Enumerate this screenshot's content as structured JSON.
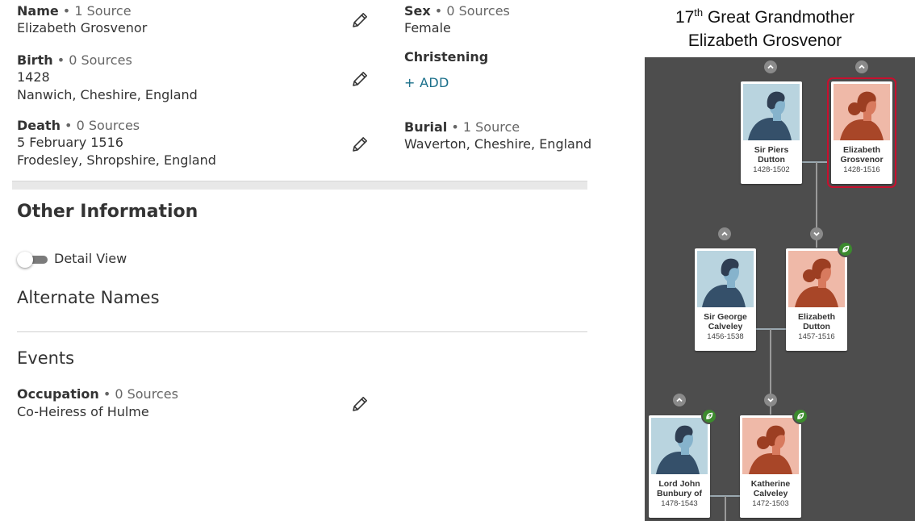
{
  "vitals": {
    "name": {
      "label": "Name",
      "sources": " • 1 Source",
      "value": "Elizabeth Grosvenor"
    },
    "sex": {
      "label": "Sex",
      "sources": " • 0 Sources",
      "value": "Female"
    },
    "birth": {
      "label": "Birth",
      "sources": " • 0 Sources",
      "date": "1428",
      "place": "Nanwich, Cheshire, England"
    },
    "christening": {
      "label": "Christening",
      "add_label": "+  ADD"
    },
    "death": {
      "label": "Death",
      "sources": " • 0 Sources",
      "date": "5 February 1516",
      "place": "Frodesley, Shropshire, England"
    },
    "burial": {
      "label": "Burial",
      "sources": " • 1 Source",
      "place": "Waverton, Cheshire, England"
    }
  },
  "other_information": {
    "heading": "Other Information",
    "detail_view": {
      "label": "Detail View",
      "on": false
    },
    "alternate_names_heading": "Alternate Names",
    "events_heading": "Events",
    "occupation": {
      "label": "Occupation",
      "sources": " • 0 Sources",
      "value": "Co-Heiress of Hulme"
    }
  },
  "caption": {
    "ordinal_num": "17",
    "ordinal_sup": "th",
    "relation": " Great Grandmother",
    "name": "Elizabeth Grosvenor"
  },
  "tree": {
    "persons": [
      {
        "id": "piers",
        "name": "Sir Piers Dutton",
        "dates": "1428-1502",
        "gender": "male",
        "selected": false
      },
      {
        "id": "elizabeth-grosvenor",
        "name": "Elizabeth Grosvenor",
        "dates": "1428-1516",
        "gender": "female",
        "selected": true
      },
      {
        "id": "george",
        "name": "Sir George Calveley",
        "dates": "1456-1538",
        "gender": "male",
        "selected": false
      },
      {
        "id": "elizabeth-dutton",
        "name": "Elizabeth Dutton",
        "dates": "1457-1516",
        "gender": "female",
        "selected": false
      },
      {
        "id": "john",
        "name": "Lord John Bunbury of",
        "dates": "1478-1543",
        "gender": "male",
        "selected": false
      },
      {
        "id": "katherine",
        "name": "Katherine Calveley",
        "dates": "1472-1503",
        "gender": "female",
        "selected": false
      }
    ],
    "colors": {
      "background": "#4d4d4d",
      "male_bg": "#b9d4df",
      "female_bg": "#efb9a8",
      "badge": "#3c8a2e",
      "selected_outline": "#c8102e"
    }
  },
  "icons": {
    "edit": "pencil-icon",
    "expand_up": "chevron-up-icon",
    "expand_down": "chevron-down-icon",
    "badge": "leaf-icon"
  }
}
